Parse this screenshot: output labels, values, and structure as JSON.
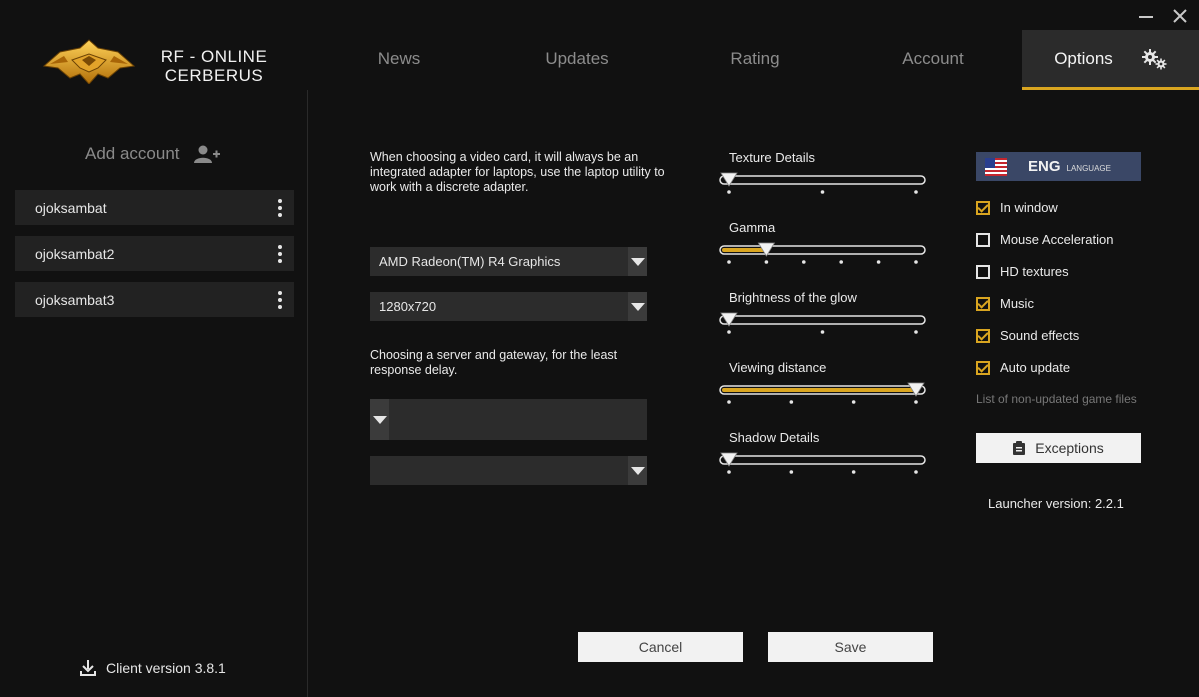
{
  "header": {
    "brand_line1": "RF - ONLINE",
    "brand_line2": "CERBERUS",
    "tabs": [
      {
        "label": "News"
      },
      {
        "label": "Updates"
      },
      {
        "label": "Rating"
      },
      {
        "label": "Account"
      },
      {
        "label": "Options"
      }
    ],
    "active_tab": "Options"
  },
  "sidebar": {
    "add_account_label": "Add account",
    "accounts": [
      {
        "name": "ojoksambat"
      },
      {
        "name": "ojoksambat2"
      },
      {
        "name": "ojoksambat3"
      }
    ],
    "client_version": "Client version 3.8.1"
  },
  "options": {
    "video_note": "When choosing a video card, it will always be an integrated adapter for laptops, use the laptop utility to work with a discrete adapter.",
    "video_card": "AMD Radeon(TM) R4 Graphics",
    "resolution": "1280x720",
    "server_note": "Choosing a server and gateway, for the least response delay.",
    "server": "",
    "gateway": "",
    "sliders": [
      {
        "label": "Texture Details",
        "steps": 3,
        "value_index": 0
      },
      {
        "label": "Gamma",
        "steps": 6,
        "value_index": 1
      },
      {
        "label": "Brightness of the glow",
        "steps": 3,
        "value_index": 0
      },
      {
        "label": "Viewing distance",
        "steps": 4,
        "value_index": 3
      },
      {
        "label": "Shadow Details",
        "steps": 4,
        "value_index": 0
      }
    ],
    "language": {
      "code": "ENG",
      "sub_label": "LANGUAGE"
    },
    "checkboxes": [
      {
        "label": "In window",
        "checked": true
      },
      {
        "label": "Mouse Acceleration",
        "checked": false
      },
      {
        "label": "HD textures",
        "checked": false
      },
      {
        "label": "Music",
        "checked": true
      },
      {
        "label": "Sound effects",
        "checked": true
      },
      {
        "label": "Auto update",
        "checked": true
      }
    ],
    "non_updated_label": "List of non-updated game files",
    "exceptions_label": "Exceptions",
    "launcher_version": "Launcher version: 2.2.1",
    "cancel_label": "Cancel",
    "save_label": "Save"
  },
  "colors": {
    "accent": "#d9a520",
    "panel": "#2c2c2c",
    "language_button": "#3a4766"
  }
}
